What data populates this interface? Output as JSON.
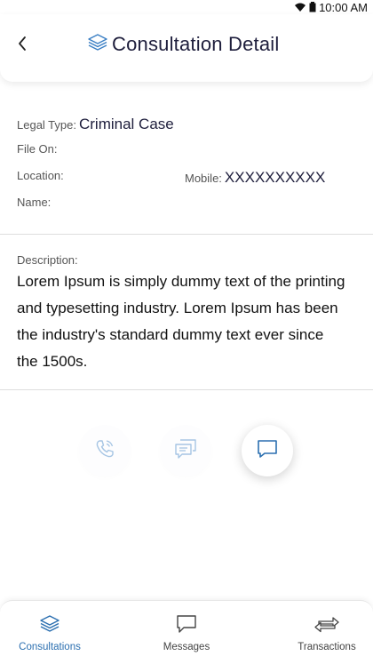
{
  "status": {
    "time": "10:00 AM",
    "wifi_icon": "wifi-icon",
    "battery_icon": "battery-icon"
  },
  "header": {
    "title": "Consultation Detail",
    "back_icon": "chevron-left-icon",
    "title_icon": "layers-icon"
  },
  "details": {
    "legal_type_label": "Legal Type:",
    "legal_type_value": "Criminal Case",
    "file_on_label": "File On:",
    "file_on_value": "",
    "location_label": "Location:",
    "location_value": "",
    "mobile_label": "Mobile:",
    "mobile_value": "XXXXXXXXXX",
    "name_label": "Name:",
    "name_value": ""
  },
  "description": {
    "label": "Description:",
    "text": "Lorem Ipsum is simply dummy text of the printing and typesetting industry. Lorem Ipsum has been the industry's standard dummy text ever since the 1500s."
  },
  "actions": [
    {
      "icon": "phone-call-icon",
      "state": "disabled"
    },
    {
      "icon": "messages-icon",
      "state": "disabled"
    },
    {
      "icon": "chat-icon",
      "state": "active"
    }
  ],
  "bottom_nav": {
    "items": [
      {
        "label": "Consultations",
        "icon": "layers-icon",
        "active": true
      },
      {
        "label": "Messages",
        "icon": "message-icon",
        "active": false
      },
      {
        "label": "Transactions",
        "icon": "transfer-icon",
        "active": false
      }
    ]
  },
  "colors": {
    "accent": "#2b6fb0",
    "title": "#1e1e3c"
  }
}
